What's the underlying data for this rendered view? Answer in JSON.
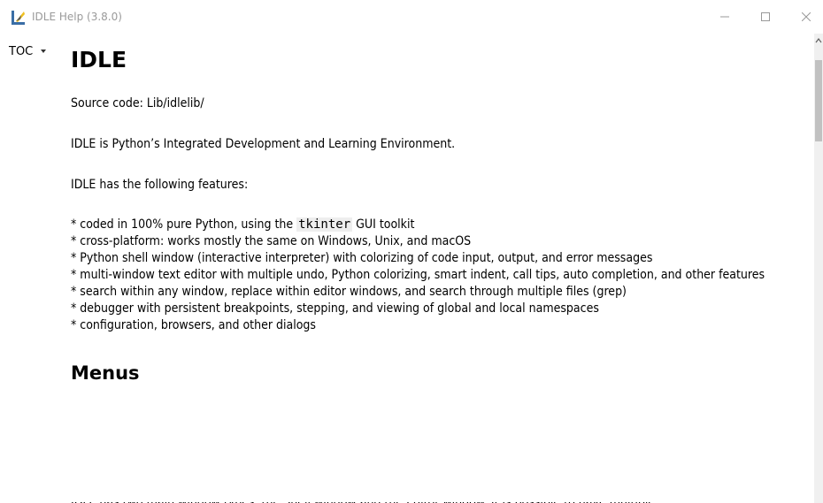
{
  "window": {
    "title": "IDLE Help (3.8.0)"
  },
  "toc": {
    "label": "TOC"
  },
  "doc": {
    "heading": "IDLE",
    "source_code": "Source code: Lib/idlelib/",
    "description": "IDLE is Python’s Integrated Development and Learning Environment.",
    "features_intro": "IDLE has the following features:",
    "features": [
      {
        "pre": "* coded in 100% pure Python, using the ",
        "code": "tkinter",
        "post": " GUI toolkit"
      },
      {
        "pre": "* cross-platform: works mostly the same on Windows, Unix, and macOS",
        "code": "",
        "post": ""
      },
      {
        "pre": "* Python shell window (interactive interpreter) with colorizing of code input, output, and error messages",
        "code": "",
        "post": ""
      },
      {
        "pre": "* multi-window text editor with multiple undo, Python colorizing, smart indent, call tips, auto completion, and other features",
        "code": "",
        "post": ""
      },
      {
        "pre": "* search within any window, replace within editor windows, and search through multiple files (grep)",
        "code": "",
        "post": ""
      },
      {
        "pre": "* debugger with persistent breakpoints, stepping, and viewing of global and local namespaces",
        "code": "",
        "post": ""
      },
      {
        "pre": "* configuration, browsers, and other dialogs",
        "code": "",
        "post": ""
      }
    ],
    "section_menus": "Menus",
    "cut_text": "IDLE has two main window types, the Shell window and the Editor window. It is possible to have multiple"
  },
  "icons": {
    "app": "idle-feather-icon",
    "minimize": "minimize-icon",
    "maximize": "maximize-icon",
    "close": "close-icon",
    "toc_caret": "caret-down-icon",
    "scroll_up": "scroll-up-arrow-icon"
  },
  "colors": {
    "title_text": "#9a9a9a",
    "code_bg": "#eeeeee",
    "scroll_track": "#f0f0f0",
    "scroll_thumb": "#c1c1c1"
  }
}
